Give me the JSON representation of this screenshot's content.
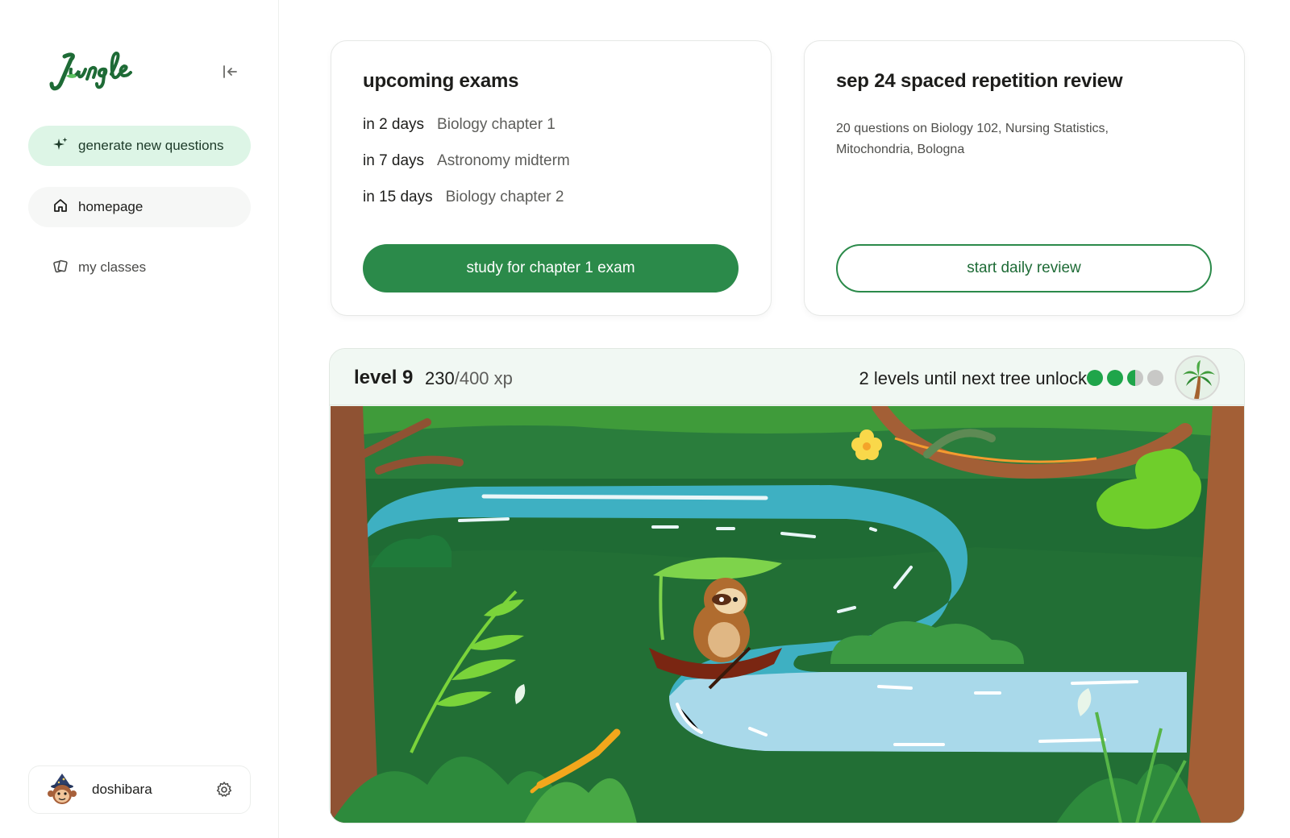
{
  "app": {
    "logo_text": "Jungle"
  },
  "sidebar": {
    "collapse_icon": "collapse-left-icon",
    "items": [
      {
        "label": "generate new questions",
        "icon": "sparkle-icon",
        "state": "highlighted"
      },
      {
        "label": "homepage",
        "icon": "home-icon",
        "state": "active"
      },
      {
        "label": "my classes",
        "icon": "cards-icon",
        "state": "default"
      }
    ],
    "user": {
      "name": "doshibara",
      "avatar": "monkey-wizard-avatar",
      "settings_icon": "gear-icon"
    }
  },
  "exams_card": {
    "title": "upcoming exams",
    "exams": [
      {
        "when": "in 2 days",
        "name": "Biology chapter 1"
      },
      {
        "when": "in 7 days",
        "name": "Astronomy midterm"
      },
      {
        "when": "in 15 days",
        "name": "Biology chapter 2"
      }
    ],
    "button_label": "study for chapter 1 exam"
  },
  "review_card": {
    "title": "sep 24 spaced repetition review",
    "description": "20 questions on Biology 102, Nursing Statistics, Mitochondria, Bologna",
    "button_label": "start daily review"
  },
  "level": {
    "label": "level 9",
    "xp_current": "230",
    "xp_rest": "/400 xp",
    "unlock_text": "2 levels until next tree unlock",
    "progress_dots": [
      "full",
      "full",
      "half",
      "empty"
    ],
    "tree_icon": "palm-tree-icon"
  },
  "colors": {
    "brand_green": "#2b8a4a",
    "highlight_green": "#ddf5e6",
    "dot_full": "#1fa54a",
    "dot_empty": "#c8c8c6"
  },
  "scene": {
    "illustration": "sloth-canoe-river-jungle"
  }
}
